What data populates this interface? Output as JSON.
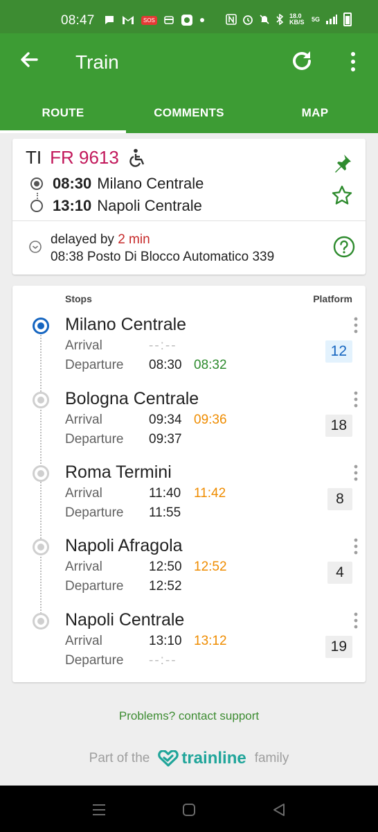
{
  "status_bar": {
    "time": "08:47",
    "network_speed": "18.0 KB/S",
    "network_type": "5G",
    "sos_label": "SOS"
  },
  "app_bar": {
    "title": "Train",
    "back_icon": "arrow-left-icon",
    "refresh_icon": "refresh-icon",
    "more_icon": "more-vert-icon"
  },
  "tabs": [
    {
      "label": "ROUTE",
      "active": true
    },
    {
      "label": "COMMENTS",
      "active": false
    },
    {
      "label": "MAP",
      "active": false
    }
  ],
  "train": {
    "category": "TI",
    "number": "FR 9613",
    "number_color": "#c2185b",
    "origin_time": "08:30",
    "origin_station": "Milano Centrale",
    "destination_time": "13:10",
    "destination_station": "Napoli Centrale",
    "delay_prefix": "delayed by",
    "delay_minutes": "2 min",
    "last_position": "08:38 Posto Di Blocco Automatico 339"
  },
  "stops_table": {
    "stops_header": "Stops",
    "platform_header": "Platform",
    "arrival_label": "Arrival",
    "departure_label": "Departure",
    "stops": [
      {
        "name": "Milano Centrale",
        "arrival": "--:--",
        "arrival_live": "",
        "departure": "08:30",
        "departure_live": "08:32",
        "platform": "12",
        "current": true
      },
      {
        "name": "Bologna Centrale",
        "arrival": "09:34",
        "arrival_live": "09:36",
        "departure": "09:37",
        "departure_live": "",
        "platform": "18",
        "current": false
      },
      {
        "name": "Roma Termini",
        "arrival": "11:40",
        "arrival_live": "11:42",
        "departure": "11:55",
        "departure_live": "",
        "platform": "8",
        "current": false
      },
      {
        "name": "Napoli Afragola",
        "arrival": "12:50",
        "arrival_live": "12:52",
        "departure": "12:52",
        "departure_live": "",
        "platform": "4",
        "current": false
      },
      {
        "name": "Napoli Centrale",
        "arrival": "13:10",
        "arrival_live": "13:12",
        "departure": "--:--",
        "departure_live": "",
        "platform": "19",
        "current": false
      }
    ]
  },
  "footer": {
    "support_link": "Problems? contact support",
    "family_prefix": "Part of the",
    "brand": "trainline",
    "family_suffix": "family"
  },
  "colors": {
    "primary_green": "#3d9c34",
    "on_time_green": "#2e8b2e",
    "delay_orange": "#ef8c00",
    "delay_red": "#c62828",
    "current_blue": "#1565c0",
    "brand_teal": "#20a59a"
  }
}
